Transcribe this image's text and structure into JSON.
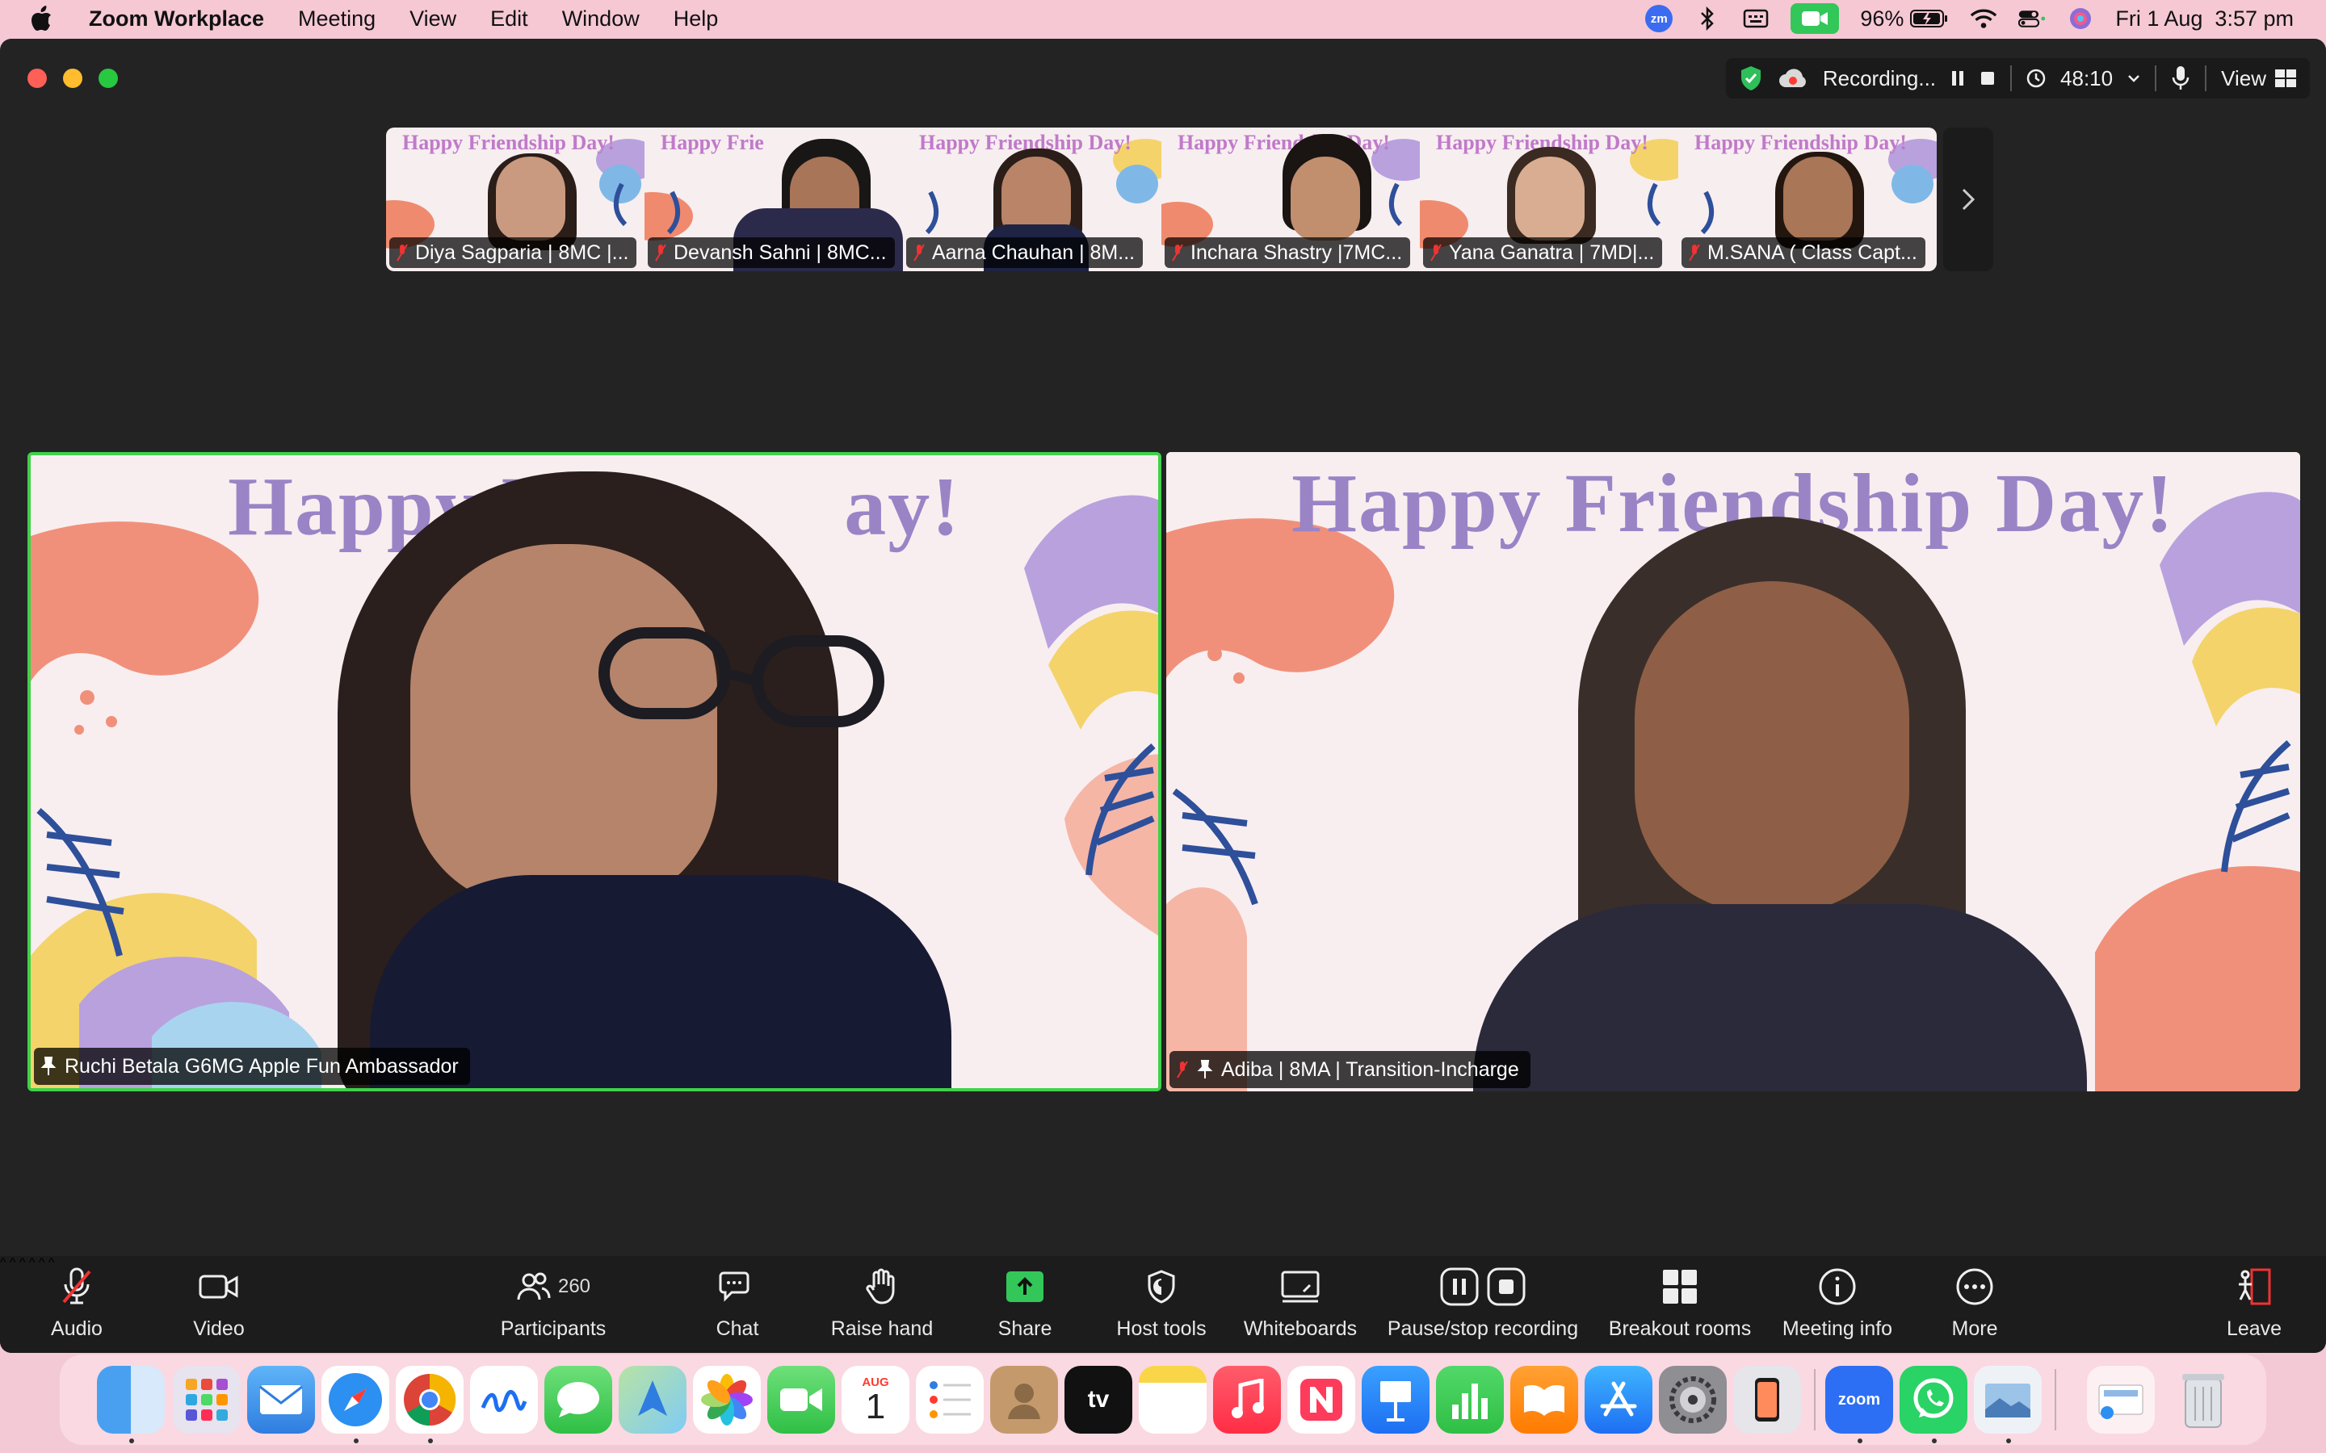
{
  "menubar": {
    "app_name": "Zoom Workplace",
    "menus": [
      "Meeting",
      "View",
      "Edit",
      "Window",
      "Help"
    ],
    "zoom_badge": "zm",
    "battery": "96%",
    "datetime": "Fri 1 Aug  3:57 pm",
    "icons": [
      "apple-icon",
      "bluetooth-icon",
      "keyboard-icon",
      "camera-active-icon",
      "battery-icon",
      "wifi-icon",
      "control-center-icon",
      "siri-icon"
    ]
  },
  "recording": {
    "status": "Recording...",
    "timer": "48:10",
    "view_label": "View"
  },
  "gallery": [
    {
      "name": "Diya Sagparia | 8MC |...",
      "banner": "Happy Friendship Day!"
    },
    {
      "name": "Devansh Sahni | 8MC...",
      "banner": "Happy Frie"
    },
    {
      "name": "Aarna Chauhan | 8M...",
      "banner": "Happy Friendship Day!"
    },
    {
      "name": "Inchara Shastry |7MC...",
      "banner": "Happy Friendship Day!"
    },
    {
      "name": "Yana Ganatra | 7MD|...",
      "banner": "Happy Friendship Day!"
    },
    {
      "name": "M.SANA ( Class Capt...",
      "banner": "Happy Friendship Day!"
    }
  ],
  "tiles": {
    "left": {
      "name": "Ruchi Betala G6MG Apple Fun Ambassador",
      "banner": "Happy Fri          ay!"
    },
    "right": {
      "name": "Adiba | 8MA | Transition-Incharge",
      "banner": "Happy Friendship Day!"
    }
  },
  "toolbar": {
    "audio": "Audio",
    "video": "Video",
    "participants": "Participants",
    "participants_count": "260",
    "chat": "Chat",
    "raise_hand": "Raise hand",
    "share": "Share",
    "host_tools": "Host tools",
    "whiteboards": "Whiteboards",
    "pause_stop": "Pause/stop recording",
    "breakout": "Breakout rooms",
    "meeting_info": "Meeting info",
    "more": "More",
    "leave": "Leave"
  },
  "dock": {
    "calendar_month": "AUG",
    "calendar_day": "1",
    "tv_label": "tv",
    "zoom_label": "zoom",
    "apps": [
      "finder",
      "launchpad",
      "mail",
      "safari",
      "chrome",
      "freeform",
      "messages",
      "maps",
      "photos",
      "facetime",
      "calendar",
      "reminders",
      "contacts",
      "apple-tv",
      "notes",
      "music",
      "news",
      "keynote",
      "numbers",
      "books",
      "app-store",
      "system-settings",
      "iphone-mirroring",
      "zoom",
      "whatsapp",
      "preview",
      "downloads",
      "trash"
    ]
  },
  "colors": {
    "active_speaker": "#3fd14a",
    "share_green": "#33c759",
    "menubar_bg": "#f5c8d4"
  }
}
